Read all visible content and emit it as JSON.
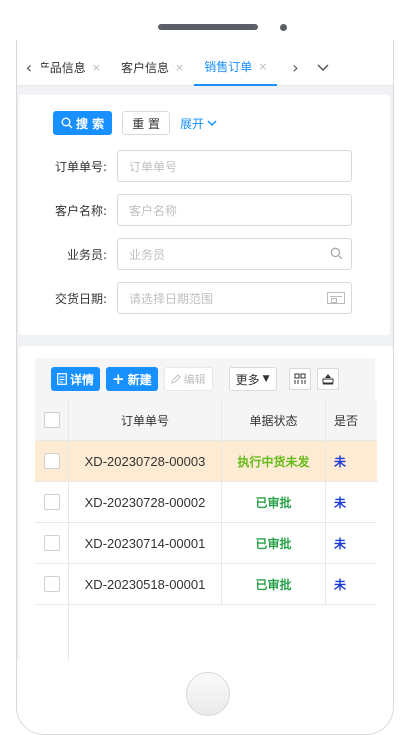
{
  "tabs": {
    "items": [
      {
        "label": "产品信息",
        "close": "×"
      },
      {
        "label": "客户信息",
        "close": "×"
      },
      {
        "label": "销售订单",
        "close": "×"
      }
    ],
    "prev_icon": "chevron-left-icon",
    "next_icon": "chevron-right-icon",
    "more_icon": "chevron-down-icon"
  },
  "search": {
    "search_label": "搜 索",
    "reset_label": "重 置",
    "expand_label": "展开",
    "fields": [
      {
        "label": "订单单号:",
        "placeholder": "订单单号"
      },
      {
        "label": "客户名称:",
        "placeholder": "客户名称"
      },
      {
        "label": "业务员:",
        "placeholder": "业务员"
      },
      {
        "label": "交货日期:",
        "placeholder": "请选择日期范围"
      }
    ]
  },
  "toolbar": {
    "detail_label": "详情",
    "new_label": "新建",
    "edit_label": "编辑",
    "more_label": "更多"
  },
  "table": {
    "columns": [
      "订单单号",
      "单据状态",
      "是否"
    ],
    "rows": [
      {
        "order_no": "XD-20230728-00003",
        "status": "执行中货未发",
        "flag": "未"
      },
      {
        "order_no": "XD-20230728-00002",
        "status": "已审批",
        "flag": "未"
      },
      {
        "order_no": "XD-20230714-00001",
        "status": "已审批",
        "flag": "未"
      },
      {
        "order_no": "XD-20230518-00001",
        "status": "已审批",
        "flag": "未"
      }
    ]
  },
  "colors": {
    "primary": "#1890ff",
    "selected_row": "#fdebd3",
    "status_warn": "#66bb1a",
    "status_ok": "#2aa24b",
    "flag": "#1c3bd7"
  }
}
